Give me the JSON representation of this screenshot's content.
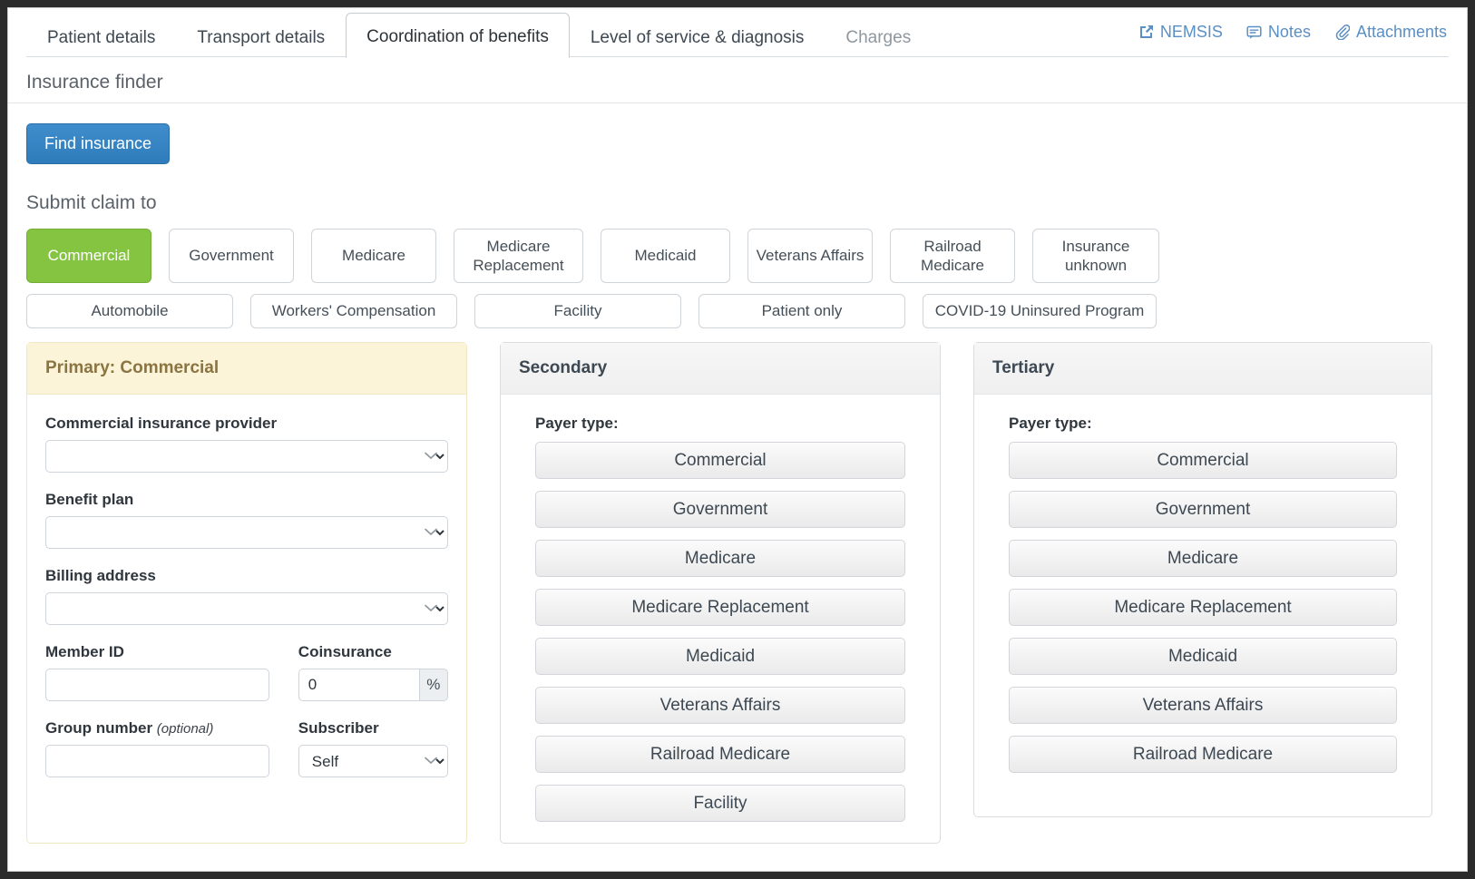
{
  "tabs": [
    {
      "label": "Patient details",
      "active": false,
      "muted": false
    },
    {
      "label": "Transport details",
      "active": false,
      "muted": false
    },
    {
      "label": "Coordination of benefits",
      "active": true,
      "muted": false
    },
    {
      "label": "Level of service & diagnosis",
      "active": false,
      "muted": false
    },
    {
      "label": "Charges",
      "active": false,
      "muted": true
    }
  ],
  "tab_actions": [
    {
      "label": "NEMSIS",
      "icon": "external-link-icon"
    },
    {
      "label": "Notes",
      "icon": "comment-icon"
    },
    {
      "label": "Attachments",
      "icon": "paperclip-icon"
    }
  ],
  "section": {
    "title": "Insurance finder",
    "find_button": "Find insurance",
    "submit_claim_heading": "Submit claim to"
  },
  "colors": {
    "accent_blue": "#2f7cbb",
    "selected_green": "#85c441",
    "primary_panel_bg": "#fcf4d9",
    "primary_panel_text": "#8a7441",
    "link_blue": "#5a8fc4"
  },
  "submit_claim_rows": [
    [
      {
        "label": "Commercial",
        "selected": true,
        "w": "w-commercial"
      },
      {
        "label": "Government",
        "selected": false,
        "w": "w-government"
      },
      {
        "label": "Medicare",
        "selected": false,
        "w": "w-medicare"
      },
      {
        "label": "Medicare Replacement",
        "selected": false,
        "w": "w-medrep"
      },
      {
        "label": "Medicaid",
        "selected": false,
        "w": "w-medicaid"
      },
      {
        "label": "Veterans Affairs",
        "selected": false,
        "w": "w-va"
      },
      {
        "label": "Railroad Medicare",
        "selected": false,
        "w": "w-rrmed"
      },
      {
        "label": "Insurance unknown",
        "selected": false,
        "w": "w-unknown"
      }
    ],
    [
      {
        "label": "Automobile",
        "selected": false,
        "w": "w-auto"
      },
      {
        "label": "Workers' Compensation",
        "selected": false,
        "w": "w-workers"
      },
      {
        "label": "Facility",
        "selected": false,
        "w": "w-facility"
      },
      {
        "label": "Patient only",
        "selected": false,
        "w": "w-patonly"
      },
      {
        "label": "COVID-19 Uninsured Program",
        "selected": false,
        "w": "w-covid"
      }
    ]
  ],
  "primary": {
    "heading": "Primary: Commercial",
    "provider_label": "Commercial insurance provider",
    "provider_value": "",
    "benefit_plan_label": "Benefit plan",
    "benefit_plan_value": "",
    "billing_address_label": "Billing address",
    "billing_address_value": "",
    "member_id_label": "Member ID",
    "member_id_value": "",
    "coinsurance_label": "Coinsurance",
    "coinsurance_value": "0",
    "coinsurance_unit": "%",
    "group_number_label": "Group number",
    "group_number_optional": "(optional)",
    "group_number_value": "",
    "subscriber_label": "Subscriber",
    "subscriber_value": "Self"
  },
  "secondary": {
    "heading": "Secondary",
    "payer_type_label": "Payer type:",
    "payer_buttons": [
      "Commercial",
      "Government",
      "Medicare",
      "Medicare Replacement",
      "Medicaid",
      "Veterans Affairs",
      "Railroad Medicare",
      "Facility"
    ]
  },
  "tertiary": {
    "heading": "Tertiary",
    "payer_type_label": "Payer type:",
    "payer_buttons": [
      "Commercial",
      "Government",
      "Medicare",
      "Medicare Replacement",
      "Medicaid",
      "Veterans Affairs",
      "Railroad Medicare"
    ]
  }
}
